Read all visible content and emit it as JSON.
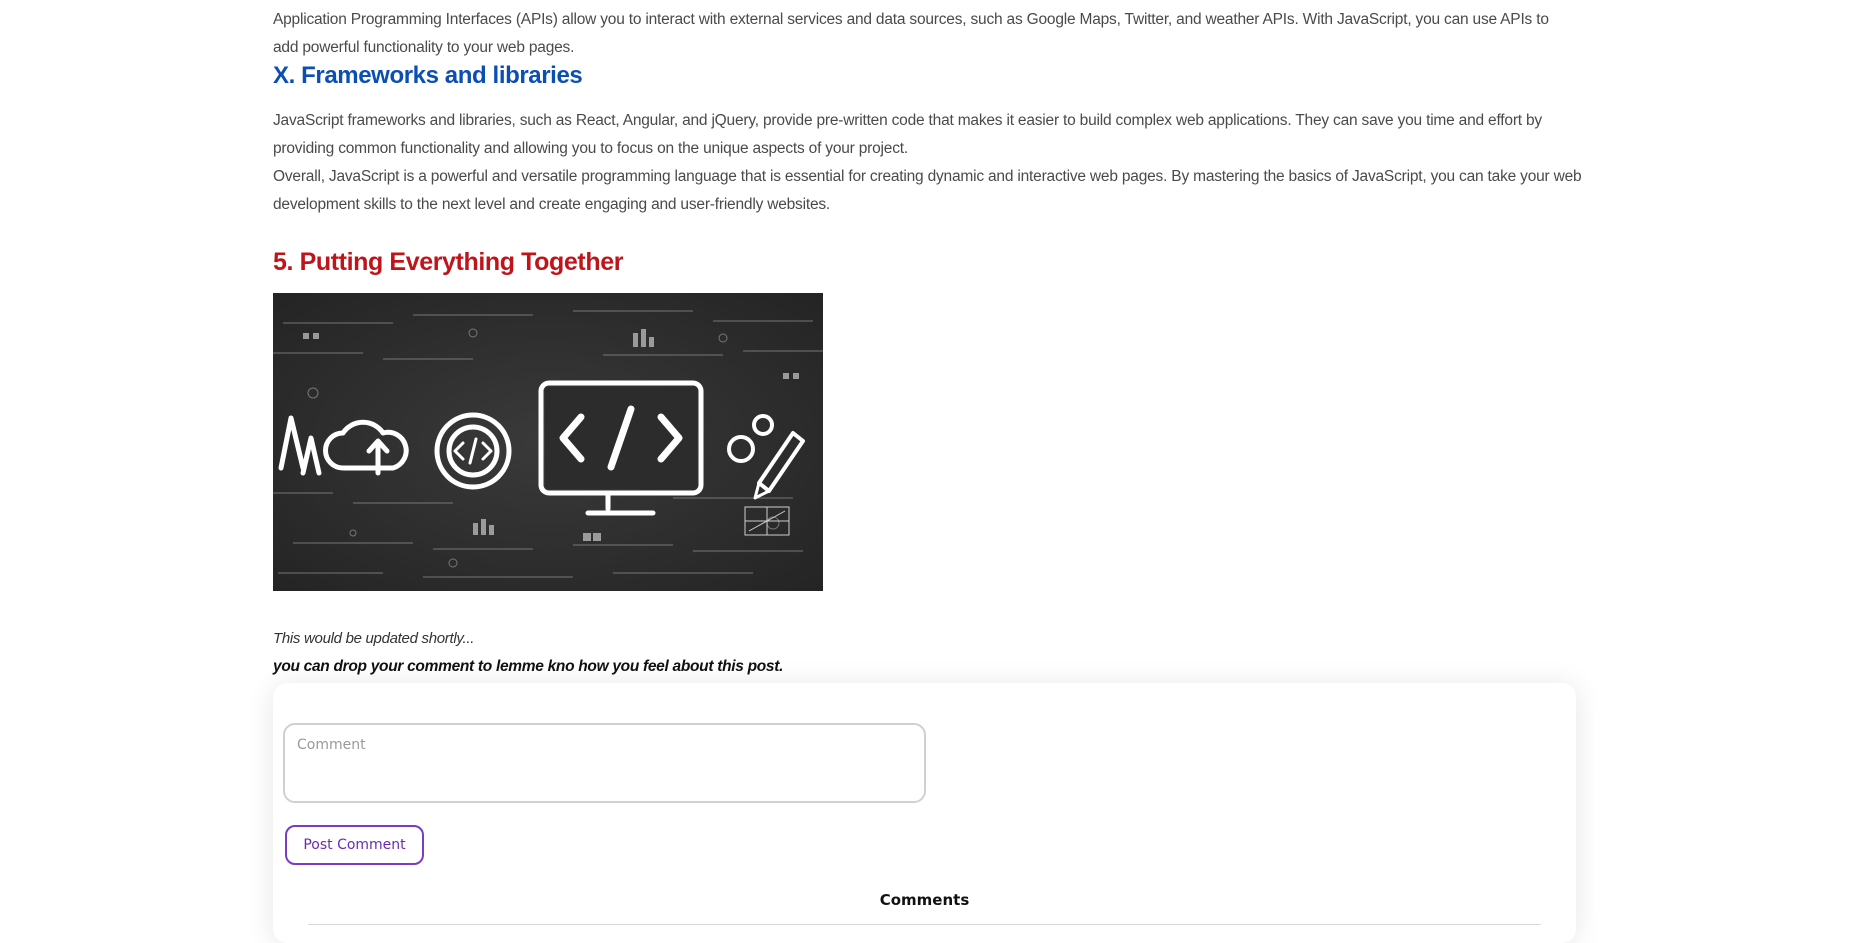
{
  "article": {
    "apis_paragraph": "Application Programming Interfaces (APIs) allow you to interact with external services and data sources, such as Google Maps, Twitter, and weather APIs. With JavaScript, you can use APIs to add powerful functionality to your web pages.",
    "frameworks_heading": "X. Frameworks and libraries",
    "frameworks_paragraph": "JavaScript frameworks and libraries, such as React, Angular, and jQuery, provide pre-written code that makes it easier to build complex web applications. They can save you time and effort by providing common functionality and allowing you to focus on the unique aspects of your project.",
    "overall_paragraph": "Overall, JavaScript is a powerful and versatile programming language that is essential for creating dynamic and interactive web pages. By mastering the basics of JavaScript, you can take your web development skills to the next level and create engaging and user-friendly websites.",
    "section5_heading": "5. Putting Everything Together",
    "image_alt": "code icons illustration",
    "update_note": "This would be updated shortly...",
    "comment_prompt": "you can drop your comment to lemme kno how you feel about this post."
  },
  "comment_form": {
    "placeholder": "Comment",
    "post_label": "Post Comment",
    "comments_title": "Comments"
  },
  "colors": {
    "heading_blue": "#0b4fb3",
    "heading_red": "#c0141b",
    "button_purple": "#7a3cc4"
  }
}
